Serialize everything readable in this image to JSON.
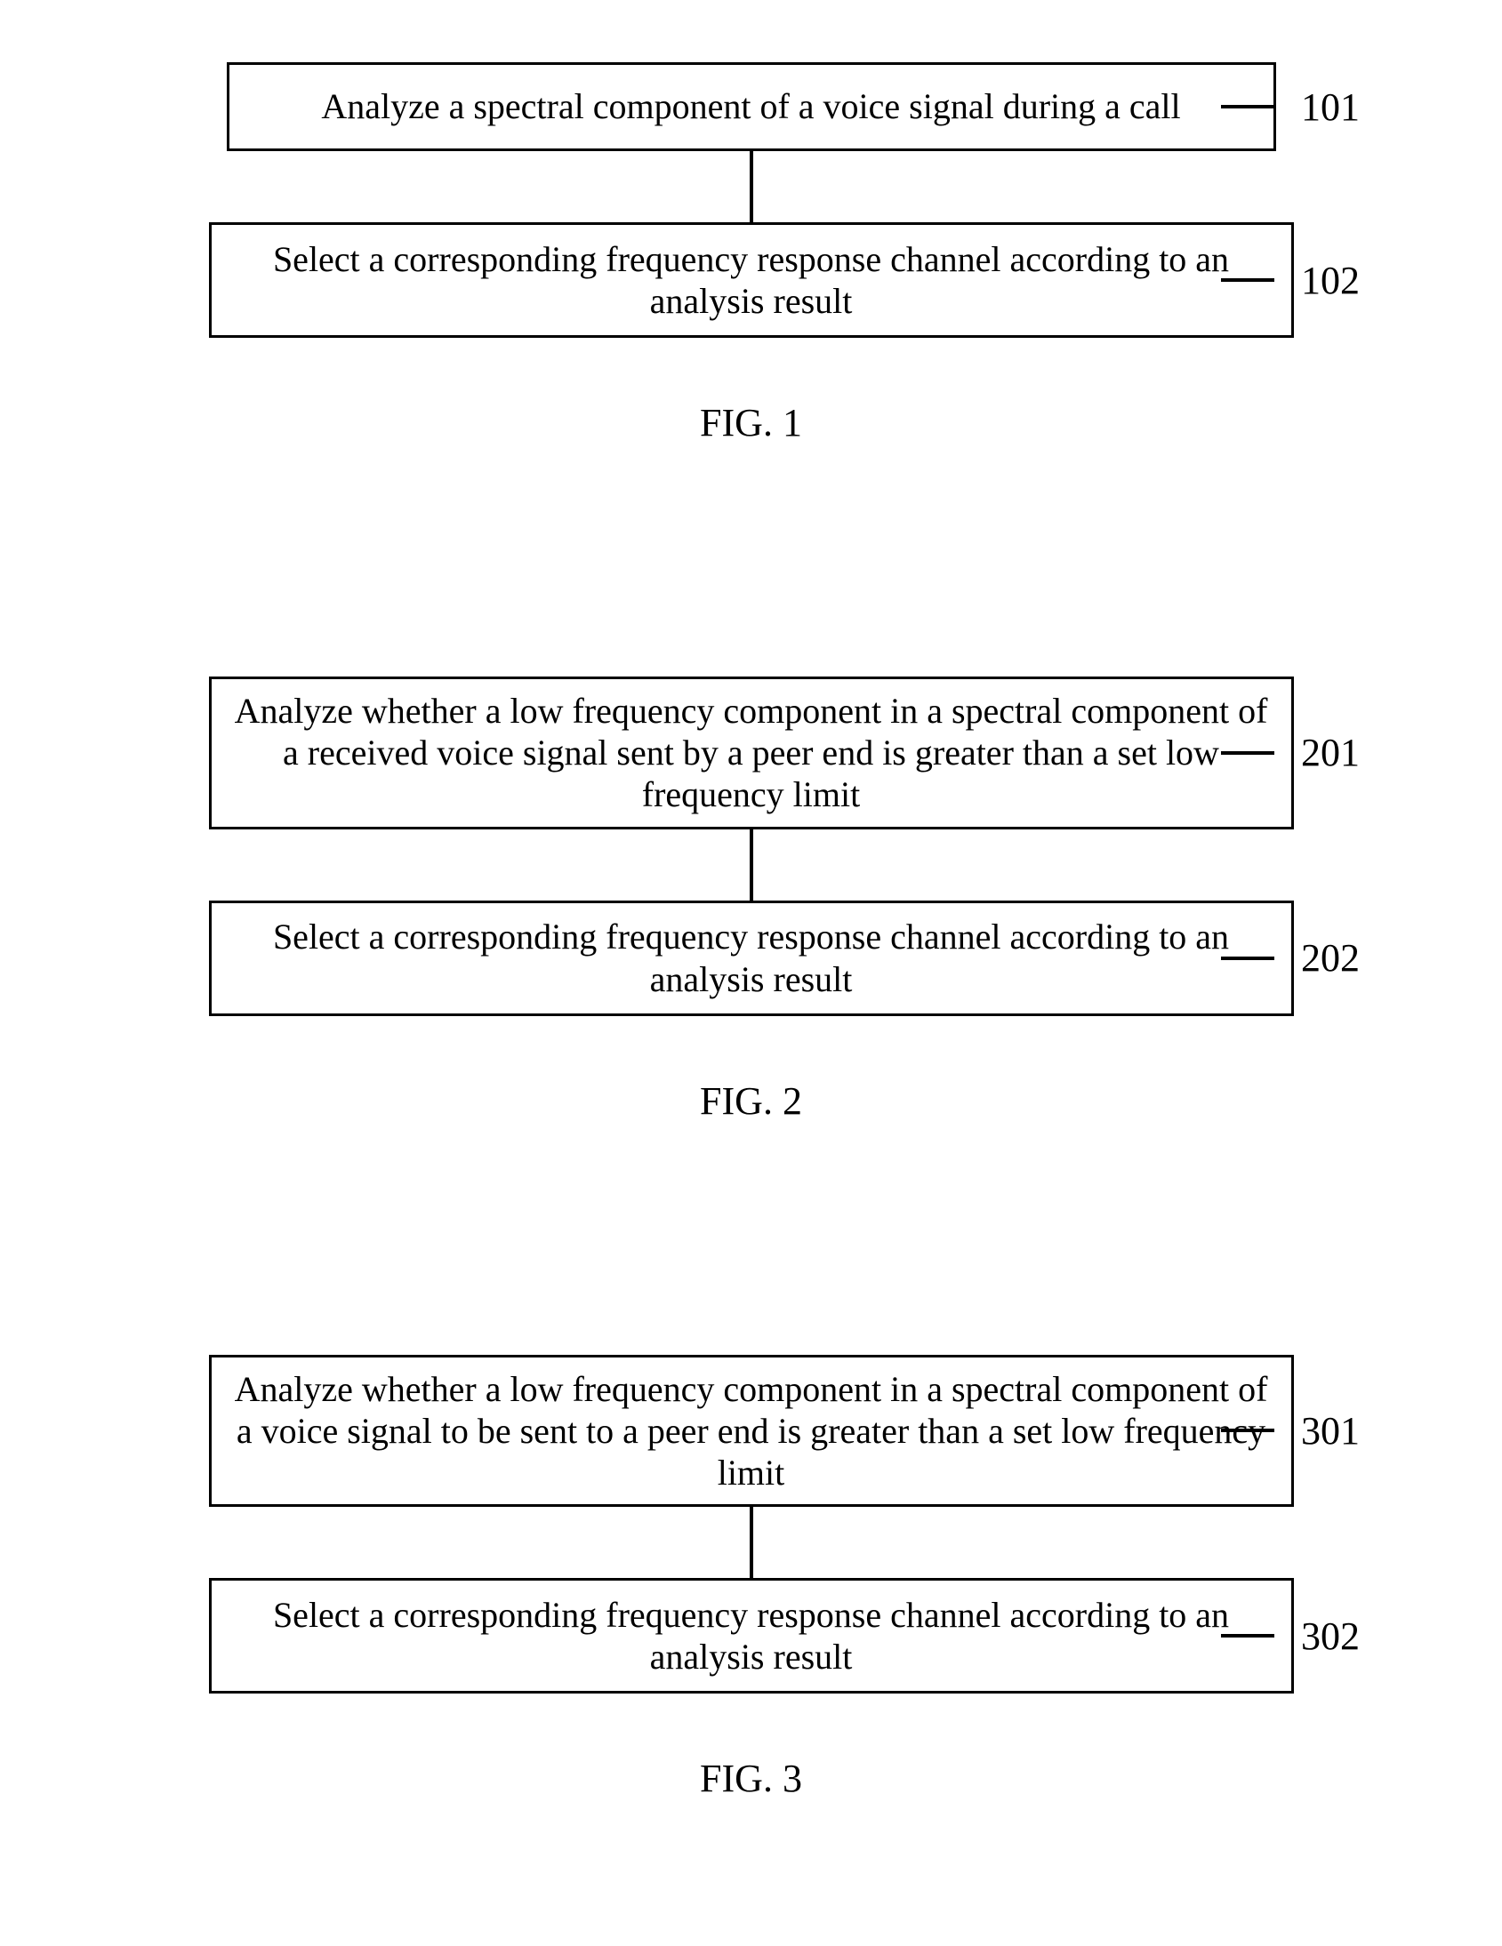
{
  "figures": [
    {
      "caption": "FIG. 1",
      "steps": [
        {
          "label": "101",
          "text": "Analyze a spectral component of a voice signal during a call"
        },
        {
          "label": "102",
          "text": "Select a corresponding frequency response channel according to an analysis result"
        }
      ]
    },
    {
      "caption": "FIG. 2",
      "steps": [
        {
          "label": "201",
          "text": "Analyze whether a low frequency component in a spectral component of a received voice signal sent by a peer end is greater than a set low frequency limit"
        },
        {
          "label": "202",
          "text": "Select a corresponding frequency response channel according to an analysis result"
        }
      ]
    },
    {
      "caption": "FIG. 3",
      "steps": [
        {
          "label": "301",
          "text": "Analyze whether a low frequency component in a spectral component of a voice signal to be sent to a peer end is greater than a set low frequency limit"
        },
        {
          "label": "302",
          "text": "Select a corresponding frequency response channel according to an analysis result"
        }
      ]
    }
  ]
}
